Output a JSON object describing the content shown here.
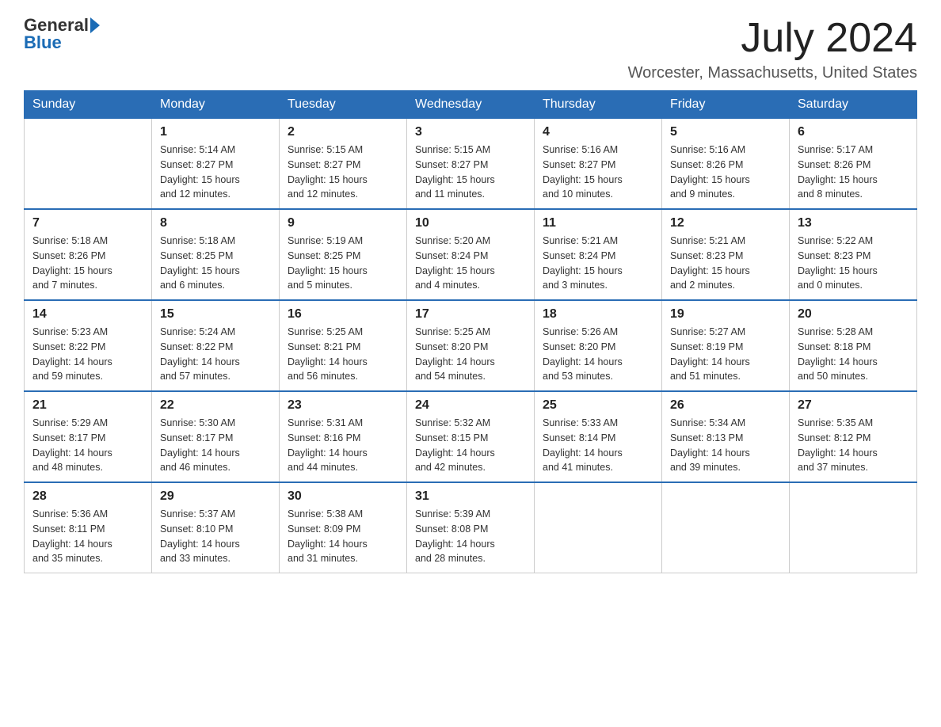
{
  "header": {
    "logo_text": "General",
    "logo_blue": "Blue",
    "month_title": "July 2024",
    "location": "Worcester, Massachusetts, United States"
  },
  "days_of_week": [
    "Sunday",
    "Monday",
    "Tuesday",
    "Wednesday",
    "Thursday",
    "Friday",
    "Saturday"
  ],
  "weeks": [
    [
      {
        "day": "",
        "info": ""
      },
      {
        "day": "1",
        "info": "Sunrise: 5:14 AM\nSunset: 8:27 PM\nDaylight: 15 hours\nand 12 minutes."
      },
      {
        "day": "2",
        "info": "Sunrise: 5:15 AM\nSunset: 8:27 PM\nDaylight: 15 hours\nand 12 minutes."
      },
      {
        "day": "3",
        "info": "Sunrise: 5:15 AM\nSunset: 8:27 PM\nDaylight: 15 hours\nand 11 minutes."
      },
      {
        "day": "4",
        "info": "Sunrise: 5:16 AM\nSunset: 8:27 PM\nDaylight: 15 hours\nand 10 minutes."
      },
      {
        "day": "5",
        "info": "Sunrise: 5:16 AM\nSunset: 8:26 PM\nDaylight: 15 hours\nand 9 minutes."
      },
      {
        "day": "6",
        "info": "Sunrise: 5:17 AM\nSunset: 8:26 PM\nDaylight: 15 hours\nand 8 minutes."
      }
    ],
    [
      {
        "day": "7",
        "info": "Sunrise: 5:18 AM\nSunset: 8:26 PM\nDaylight: 15 hours\nand 7 minutes."
      },
      {
        "day": "8",
        "info": "Sunrise: 5:18 AM\nSunset: 8:25 PM\nDaylight: 15 hours\nand 6 minutes."
      },
      {
        "day": "9",
        "info": "Sunrise: 5:19 AM\nSunset: 8:25 PM\nDaylight: 15 hours\nand 5 minutes."
      },
      {
        "day": "10",
        "info": "Sunrise: 5:20 AM\nSunset: 8:24 PM\nDaylight: 15 hours\nand 4 minutes."
      },
      {
        "day": "11",
        "info": "Sunrise: 5:21 AM\nSunset: 8:24 PM\nDaylight: 15 hours\nand 3 minutes."
      },
      {
        "day": "12",
        "info": "Sunrise: 5:21 AM\nSunset: 8:23 PM\nDaylight: 15 hours\nand 2 minutes."
      },
      {
        "day": "13",
        "info": "Sunrise: 5:22 AM\nSunset: 8:23 PM\nDaylight: 15 hours\nand 0 minutes."
      }
    ],
    [
      {
        "day": "14",
        "info": "Sunrise: 5:23 AM\nSunset: 8:22 PM\nDaylight: 14 hours\nand 59 minutes."
      },
      {
        "day": "15",
        "info": "Sunrise: 5:24 AM\nSunset: 8:22 PM\nDaylight: 14 hours\nand 57 minutes."
      },
      {
        "day": "16",
        "info": "Sunrise: 5:25 AM\nSunset: 8:21 PM\nDaylight: 14 hours\nand 56 minutes."
      },
      {
        "day": "17",
        "info": "Sunrise: 5:25 AM\nSunset: 8:20 PM\nDaylight: 14 hours\nand 54 minutes."
      },
      {
        "day": "18",
        "info": "Sunrise: 5:26 AM\nSunset: 8:20 PM\nDaylight: 14 hours\nand 53 minutes."
      },
      {
        "day": "19",
        "info": "Sunrise: 5:27 AM\nSunset: 8:19 PM\nDaylight: 14 hours\nand 51 minutes."
      },
      {
        "day": "20",
        "info": "Sunrise: 5:28 AM\nSunset: 8:18 PM\nDaylight: 14 hours\nand 50 minutes."
      }
    ],
    [
      {
        "day": "21",
        "info": "Sunrise: 5:29 AM\nSunset: 8:17 PM\nDaylight: 14 hours\nand 48 minutes."
      },
      {
        "day": "22",
        "info": "Sunrise: 5:30 AM\nSunset: 8:17 PM\nDaylight: 14 hours\nand 46 minutes."
      },
      {
        "day": "23",
        "info": "Sunrise: 5:31 AM\nSunset: 8:16 PM\nDaylight: 14 hours\nand 44 minutes."
      },
      {
        "day": "24",
        "info": "Sunrise: 5:32 AM\nSunset: 8:15 PM\nDaylight: 14 hours\nand 42 minutes."
      },
      {
        "day": "25",
        "info": "Sunrise: 5:33 AM\nSunset: 8:14 PM\nDaylight: 14 hours\nand 41 minutes."
      },
      {
        "day": "26",
        "info": "Sunrise: 5:34 AM\nSunset: 8:13 PM\nDaylight: 14 hours\nand 39 minutes."
      },
      {
        "day": "27",
        "info": "Sunrise: 5:35 AM\nSunset: 8:12 PM\nDaylight: 14 hours\nand 37 minutes."
      }
    ],
    [
      {
        "day": "28",
        "info": "Sunrise: 5:36 AM\nSunset: 8:11 PM\nDaylight: 14 hours\nand 35 minutes."
      },
      {
        "day": "29",
        "info": "Sunrise: 5:37 AM\nSunset: 8:10 PM\nDaylight: 14 hours\nand 33 minutes."
      },
      {
        "day": "30",
        "info": "Sunrise: 5:38 AM\nSunset: 8:09 PM\nDaylight: 14 hours\nand 31 minutes."
      },
      {
        "day": "31",
        "info": "Sunrise: 5:39 AM\nSunset: 8:08 PM\nDaylight: 14 hours\nand 28 minutes."
      },
      {
        "day": "",
        "info": ""
      },
      {
        "day": "",
        "info": ""
      },
      {
        "day": "",
        "info": ""
      }
    ]
  ]
}
